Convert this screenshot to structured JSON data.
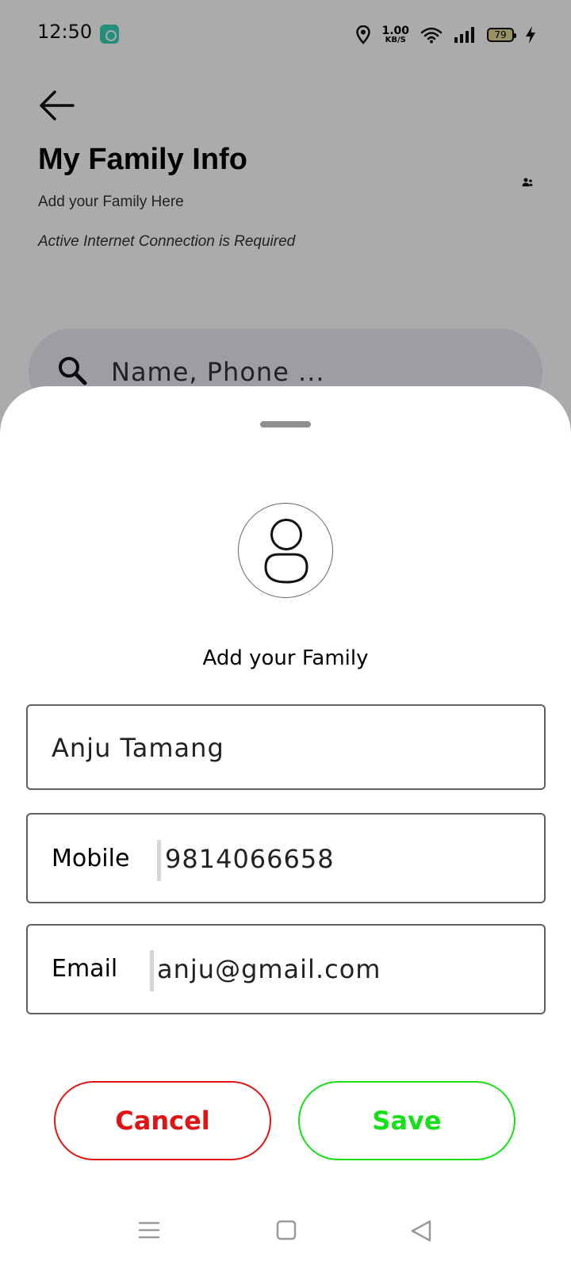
{
  "status_bar": {
    "time": "12:50",
    "net_speed_value": "1.00",
    "net_speed_unit": "KB/S",
    "battery_level": "79"
  },
  "header": {
    "title": "My Family Info",
    "subtitle": "Add your Family Here",
    "note": "Active Internet Connection is Required"
  },
  "search": {
    "placeholder": "Name, Phone ..."
  },
  "sheet": {
    "heading": "Add your Family",
    "name_value": "Anju Tamang",
    "mobile_label": "Mobile",
    "mobile_value": "9814066658",
    "email_label": "Email",
    "email_value": "anju@gmail.com",
    "cancel_label": "Cancel",
    "save_label": "Save"
  },
  "colors": {
    "cancel": "#e01414",
    "save": "#18e018",
    "status_app_icon": "#33d4b8",
    "scrim": "rgba(0,0,0,0.33)"
  },
  "icons": [
    "back-arrow-icon",
    "location-icon",
    "wifi-icon",
    "signal-icon",
    "battery-icon",
    "charging-icon",
    "people-icon",
    "search-icon",
    "person-icon",
    "menu-icon",
    "home-icon",
    "back-triangle-icon"
  ]
}
